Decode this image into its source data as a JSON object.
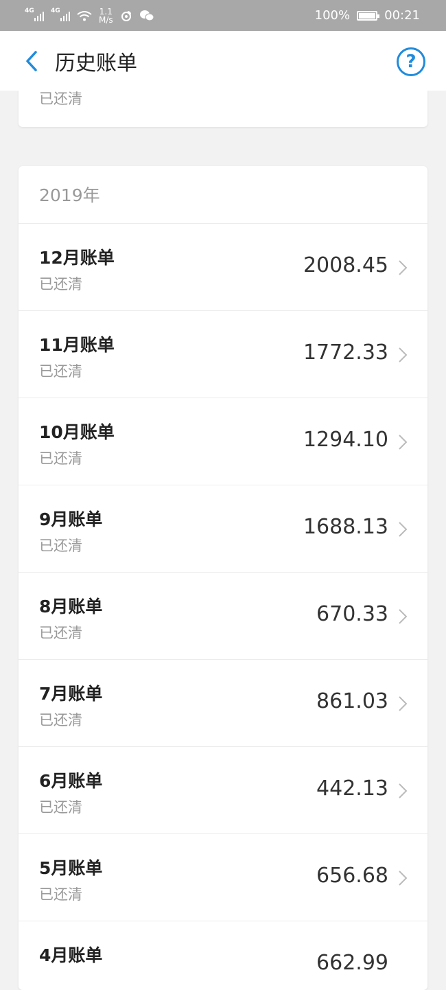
{
  "status_bar": {
    "net1": "4G",
    "net2": "4G",
    "speed_value": "1.1",
    "speed_unit": "M/s",
    "battery": "100%",
    "time": "00:21"
  },
  "header": {
    "title": "历史账单"
  },
  "previous_card": {
    "status": "已还清"
  },
  "section": {
    "year": "2019年",
    "bills": [
      {
        "month": "12月账单",
        "status": "已还清",
        "amount": "2008.45"
      },
      {
        "month": "11月账单",
        "status": "已还清",
        "amount": "1772.33"
      },
      {
        "month": "10月账单",
        "status": "已还清",
        "amount": "1294.10"
      },
      {
        "month": "9月账单",
        "status": "已还清",
        "amount": "1688.13"
      },
      {
        "month": "8月账单",
        "status": "已还清",
        "amount": "670.33"
      },
      {
        "month": "7月账单",
        "status": "已还清",
        "amount": "861.03"
      },
      {
        "month": "6月账单",
        "status": "已还清",
        "amount": "442.13"
      },
      {
        "month": "5月账单",
        "status": "已还清",
        "amount": "656.68"
      },
      {
        "month": "4月账单",
        "amount": "662.99"
      }
    ]
  },
  "colors": {
    "accent": "#1f8bdc",
    "status_bar": "#a8a8a8",
    "background": "#f2f2f2"
  },
  "icons": {
    "back": "chevron-left-icon",
    "help": "question-circle-icon",
    "row": "chevron-right-icon"
  }
}
